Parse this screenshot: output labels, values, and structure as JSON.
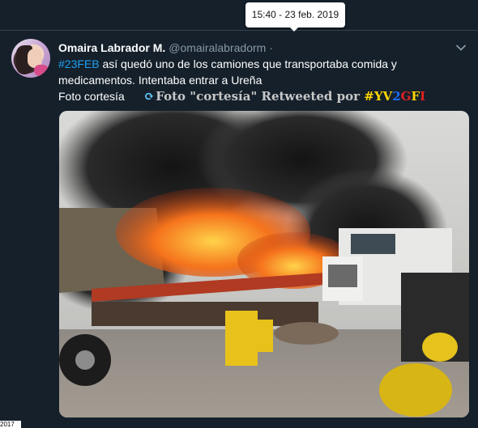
{
  "tooltip": {
    "text": "15:40 - 23 feb. 2019"
  },
  "tweet": {
    "display_name": "Omaira Labrador M.",
    "handle": "@omairalabradorm",
    "separator": "·",
    "hashtag": "#23FEB",
    "text_line1_rest": " así quedó uno de los camiones que transportaba comida y",
    "text_line2": "medicamentos. Intentaba entrar a Ureña",
    "text_line3": "Foto cortesía",
    "more_icon": "chevron-down-icon"
  },
  "retweet_banner": {
    "icon": "retweet-icon",
    "prefix": "Foto \"cortesía\" Retweeted por ",
    "hash": "#",
    "yv": "YV",
    "two": "2",
    "g": "G",
    "f": "F",
    "i": "I"
  },
  "media": {
    "description_icon": "photo"
  },
  "corner_label": "2017",
  "colors": {
    "background": "#15202b",
    "link": "#1da1f2",
    "secondary_text": "#8899a6",
    "divider": "#38444d"
  }
}
